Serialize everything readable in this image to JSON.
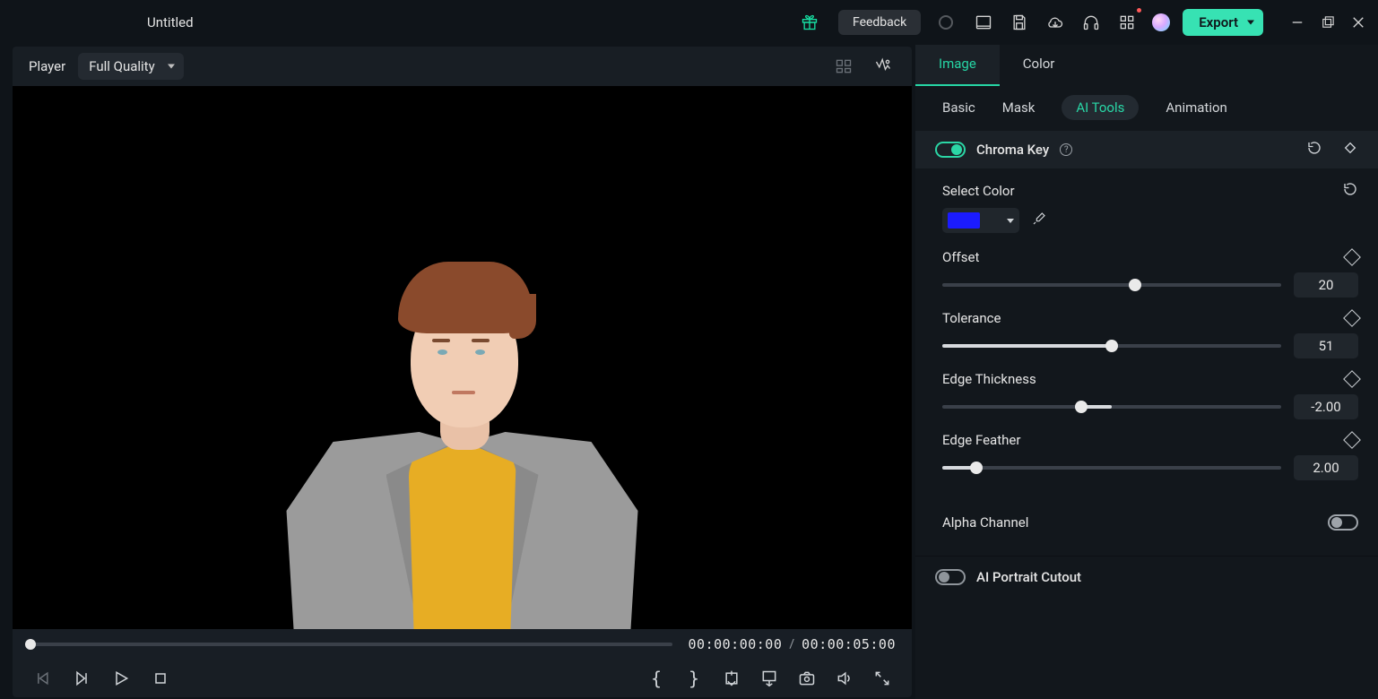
{
  "topbar": {
    "title": "Untitled",
    "feedback_label": "Feedback",
    "export_label": "Export"
  },
  "player": {
    "label": "Player",
    "quality": "Full Quality",
    "current_time": "00:00:00:00",
    "duration": "00:00:05:00",
    "separator": "/"
  },
  "panel": {
    "tabs_primary": {
      "image": "Image",
      "color": "Color"
    },
    "tabs_secondary": {
      "basic": "Basic",
      "mask": "Mask",
      "ai_tools": "AI Tools",
      "animation": "Animation"
    },
    "chroma": {
      "title": "Chroma Key",
      "select_color_label": "Select Color",
      "selected_color": "#1b1bff",
      "offset": {
        "label": "Offset",
        "value": "20",
        "percent": 57
      },
      "tolerance": {
        "label": "Tolerance",
        "value": "51",
        "percent": 50
      },
      "edge_thickness": {
        "label": "Edge Thickness",
        "value": "-2.00",
        "percent": 41
      },
      "edge_feather": {
        "label": "Edge Feather",
        "value": "2.00",
        "percent": 10
      }
    },
    "alpha_channel_label": "Alpha Channel",
    "cutout": {
      "title": "AI Portrait Cutout"
    }
  }
}
